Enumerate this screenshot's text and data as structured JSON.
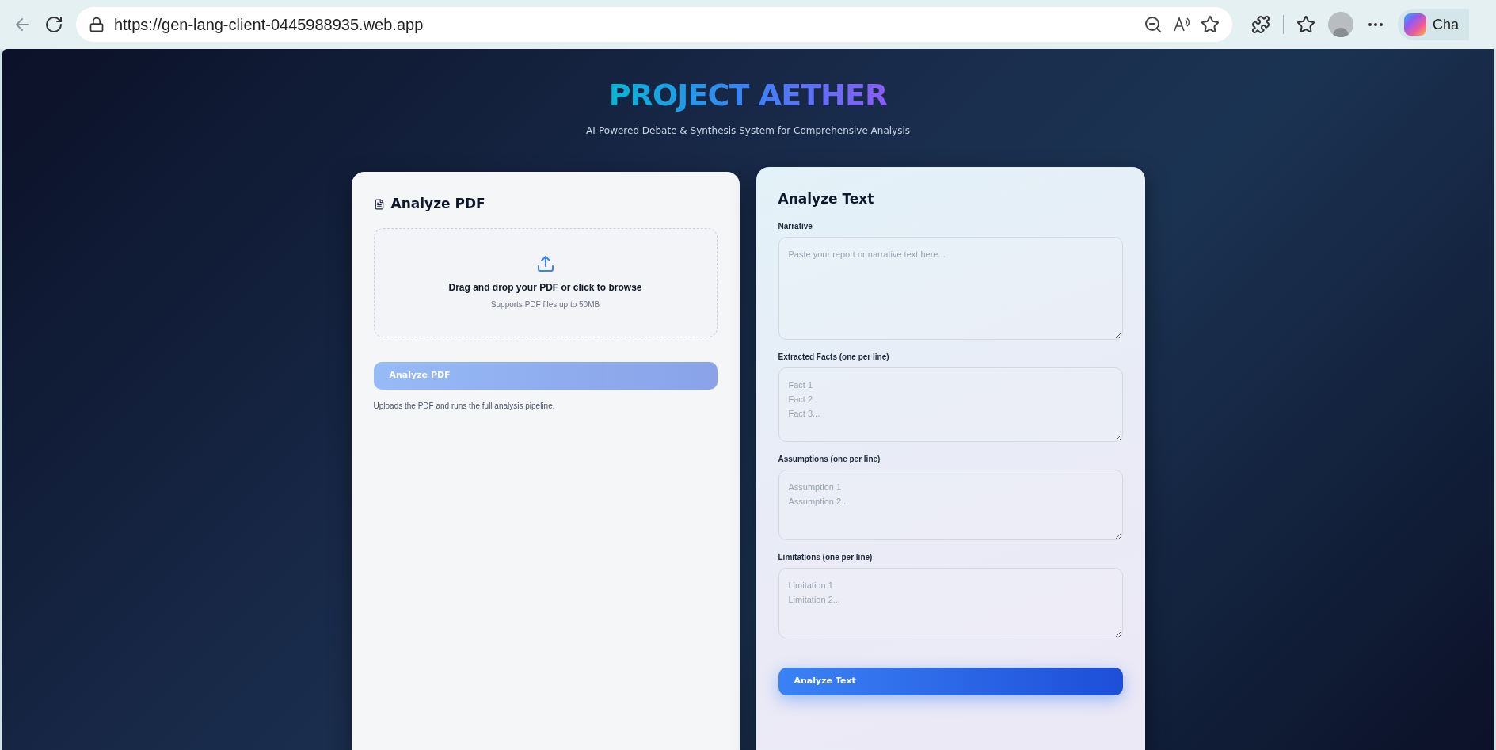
{
  "browser": {
    "url": "https://gen-lang-client-0445988935.web.app",
    "copilot_label": "Cha"
  },
  "header": {
    "title": "PROJECT AETHER",
    "subtitle": "AI-Powered Debate & Synthesis System for Comprehensive Analysis"
  },
  "pdf_panel": {
    "title": "Analyze PDF",
    "dropzone": {
      "title": "Drag and drop your PDF or click to browse",
      "hint": "Supports PDF files up to 50MB"
    },
    "button": {
      "label": "Analyze PDF",
      "disabled": true
    },
    "note": "Uploads the PDF and runs the full analysis pipeline."
  },
  "text_panel": {
    "title": "Analyze Text",
    "fields": [
      {
        "label": "Narrative",
        "placeholder": "Paste your report or narrative text here..."
      },
      {
        "label": "Extracted Facts (one per line)",
        "placeholder": "Fact 1\nFact 2\nFact 3..."
      },
      {
        "label": "Assumptions (one per line)",
        "placeholder": "Assumption 1\nAssumption 2..."
      },
      {
        "label": "Limitations (one per line)",
        "placeholder": "Limitation 1\nLimitation 2..."
      }
    ],
    "button": {
      "label": "Analyze Text",
      "disabled": false
    }
  }
}
